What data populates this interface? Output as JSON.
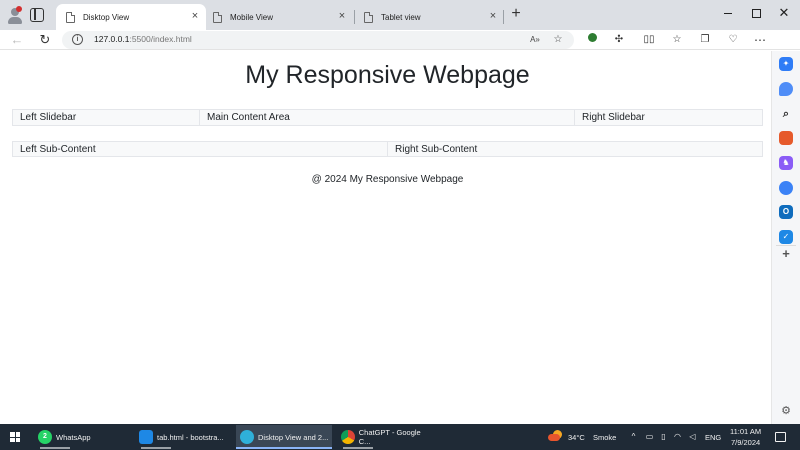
{
  "browser": {
    "tabs": [
      {
        "title": "Disktop View",
        "active": true
      },
      {
        "title": "Mobile View",
        "active": false
      },
      {
        "title": "Tablet view",
        "active": false
      }
    ],
    "address": {
      "host": "127.0.0.1",
      "rest": ":5500/index.html"
    }
  },
  "page": {
    "title": "My Responsive Webpage",
    "row1": {
      "left": "Left Slidebar",
      "main": "Main Content Area",
      "right": "Right Slidebar"
    },
    "row2": {
      "left": "Left Sub-Content",
      "right": "Right Sub-Content"
    },
    "footer": "@ 2024 My Responsive Webpage"
  },
  "taskbar": {
    "apps": [
      {
        "label": "WhatsApp",
        "badge": "2"
      },
      {
        "label": "tab.html - bootstra..."
      },
      {
        "label": "Disktop View and 2..."
      },
      {
        "label": "ChatGPT - Google C..."
      }
    ],
    "weather": {
      "temp": "34°C",
      "condition": "Smoke"
    },
    "language": "ENG",
    "time": "11:01 AM",
    "date": "7/9/2024"
  },
  "colors": {
    "tabstrip": "#dcdfe4",
    "taskbar": "#1f2a36",
    "cell_bg": "#f8f9fa",
    "cell_border": "#e4e6ea"
  }
}
